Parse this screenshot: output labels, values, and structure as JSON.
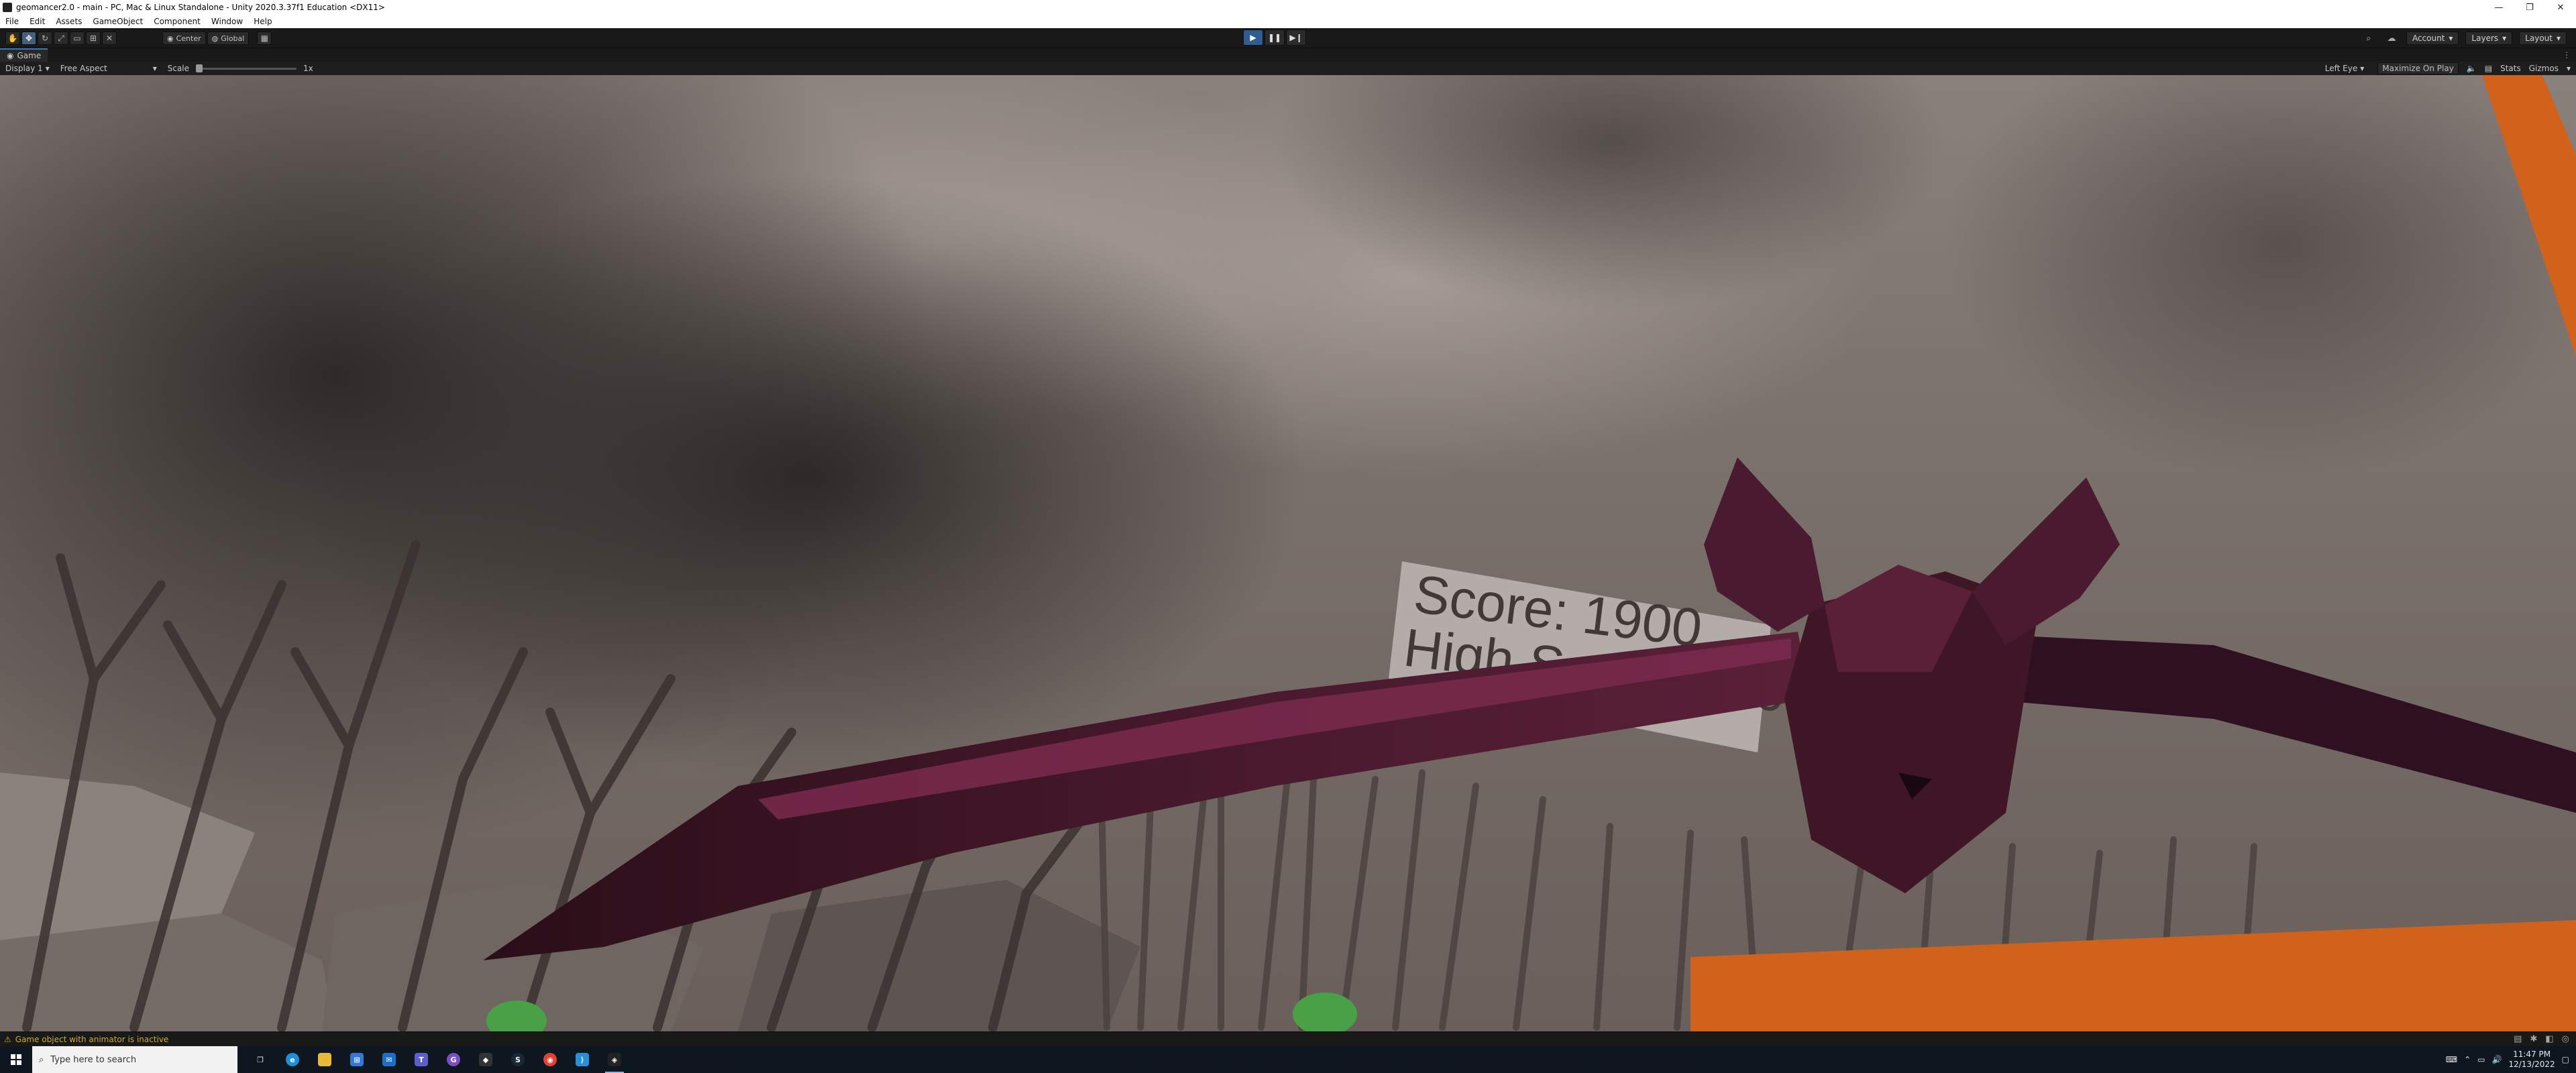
{
  "window": {
    "title": "geomancer2.0 - main - PC, Mac & Linux Standalone - Unity 2020.3.37f1 Education <DX11>",
    "controls": [
      "—",
      "❐",
      "✕"
    ]
  },
  "menu": [
    "File",
    "Edit",
    "Assets",
    "GameObject",
    "Component",
    "Window",
    "Help"
  ],
  "toolbar": {
    "tools": [
      "hand-icon",
      "move-icon",
      "rotate-icon",
      "scale-icon",
      "rect-icon",
      "transform-icon",
      "custom-tool-icon"
    ],
    "pivot_label": "Center",
    "space_label": "Global",
    "play_controls": [
      "play-icon",
      "pause-icon",
      "step-icon"
    ],
    "account_label": "Account",
    "layers_label": "Layers",
    "layout_label": "Layout"
  },
  "game_tab": {
    "label": "Game"
  },
  "game_toolbar": {
    "display": "Display 1",
    "aspect": "Free Aspect",
    "scale_label": "Scale",
    "scale_value": "1x",
    "eye": "Left Eye",
    "maximize": "Maximize On Play",
    "stats": "Stats",
    "gizmos": "Gizmos"
  },
  "scene": {
    "score_text": "Score: 1900",
    "highscore_text": "High Score: 70900"
  },
  "status": {
    "message": "Game object with animator is inactive"
  },
  "taskbar": {
    "search_placeholder": "Type here to search",
    "time": "11:47 PM",
    "date": "12/13/2022"
  },
  "colors": {
    "accent_play": "#2f5d8f",
    "warning": "#cfae2f",
    "bat": "#3e1626",
    "orange": "#d0621c"
  }
}
